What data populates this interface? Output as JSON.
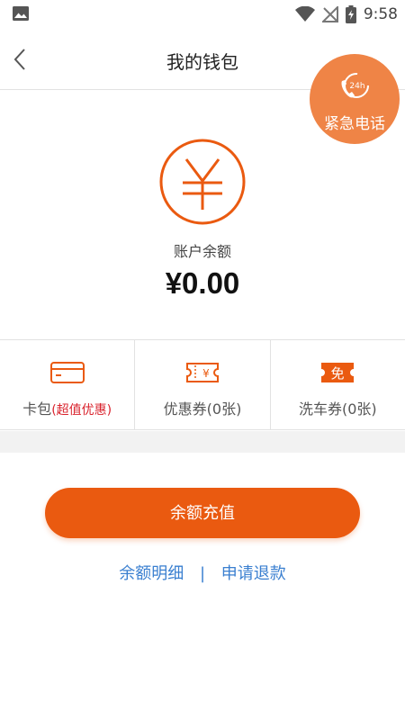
{
  "status_bar": {
    "time": "9:58"
  },
  "nav": {
    "title": "我的钱包"
  },
  "emergency": {
    "label": "紧急电话",
    "icon_text": "24h"
  },
  "balance": {
    "label": "账户余额",
    "value": "¥0.00"
  },
  "tiles": [
    {
      "label": "卡包",
      "highlight": "(超值优惠)",
      "icon": "card-icon"
    },
    {
      "label": "优惠券(0张)",
      "icon": "coupon-icon",
      "icon_glyph": "¥"
    },
    {
      "label": "洗车券(0张)",
      "icon": "free-ticket-icon",
      "icon_glyph": "免"
    }
  ],
  "actions": {
    "recharge": "余额充值",
    "detail_link": "余额明细",
    "separator": "|",
    "refund_link": "申请退款"
  },
  "colors": {
    "accent": "#ea5a10",
    "emergency": "#ef8446",
    "link": "#3a7fd0",
    "highlight": "#d9232d"
  }
}
